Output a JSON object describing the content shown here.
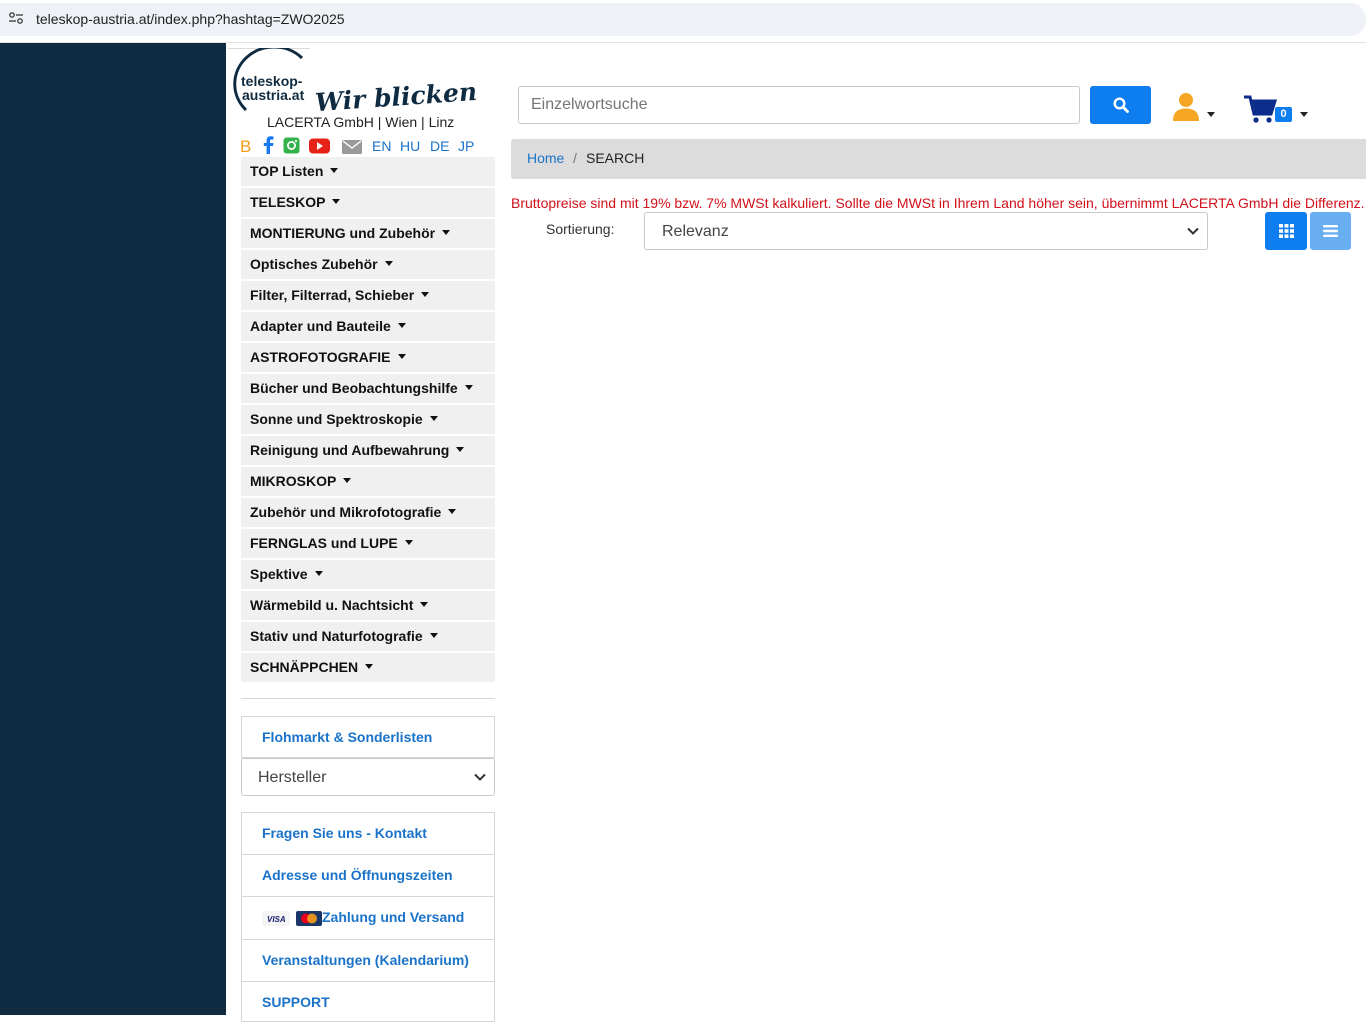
{
  "browser": {
    "url": "teleskop-austria.at/index.php?hashtag=ZWO2025"
  },
  "header": {
    "logo_text_line1": "teleskop-",
    "logo_text_line2": "austria.at",
    "logo_slogan": "Wir blicken durch",
    "company": "LACERTA GmbH | Wien | Linz",
    "languages": [
      "EN",
      "HU",
      "DE",
      "JP"
    ],
    "search_placeholder": "Einzelwortsuche",
    "cart_count": "0"
  },
  "menu": {
    "categories": [
      "TOP Listen",
      "TELESKOP",
      "MONTIERUNG und Zubehör",
      "Optisches Zubehör",
      "Filter, Filterrad, Schieber",
      "Adapter und Bauteile",
      "ASTROFOTOGRAFIE",
      "Bücher und Beobachtungshilfe",
      "Sonne und Spektroskopie",
      "Reinigung und Aufbewahrung",
      "MIKROSKOP",
      "Zubehör und Mikrofotografie",
      "FERNGLAS und LUPE",
      "Spektive",
      "Wärmebild u. Nachtsicht",
      "Stativ und Naturfotografie",
      "SCHNÄPPCHEN"
    ],
    "flohmarkt": "Flohmarkt & Sonderlisten",
    "manufacturer_select": "Hersteller",
    "info_links": {
      "contact": "Fragen Sie uns - Kontakt",
      "address": "Adresse und Öffnungszeiten",
      "payment": "Zahlung und Versand",
      "events": "Veranstaltungen (Kalendarium)",
      "support": "SUPPORT"
    },
    "card_visa": "VISA"
  },
  "breadcrumb": {
    "home": "Home",
    "separator": "/",
    "current": "SEARCH"
  },
  "main": {
    "notice": "Bruttopreise sind mit 19% bzw. 7% MWSt kalkuliert. Sollte die MWSt in Ihrem Land höher sein, übernimmt LACERTA GmbH die Differenz.",
    "sort_label": "Sortierung:",
    "sort_value": "Relevanz"
  },
  "colors": {
    "sidebar_dark": "#0f2b41",
    "link_blue": "#1a73c9",
    "accent_blue": "#0d7df0",
    "notice_red": "#d1101a"
  }
}
